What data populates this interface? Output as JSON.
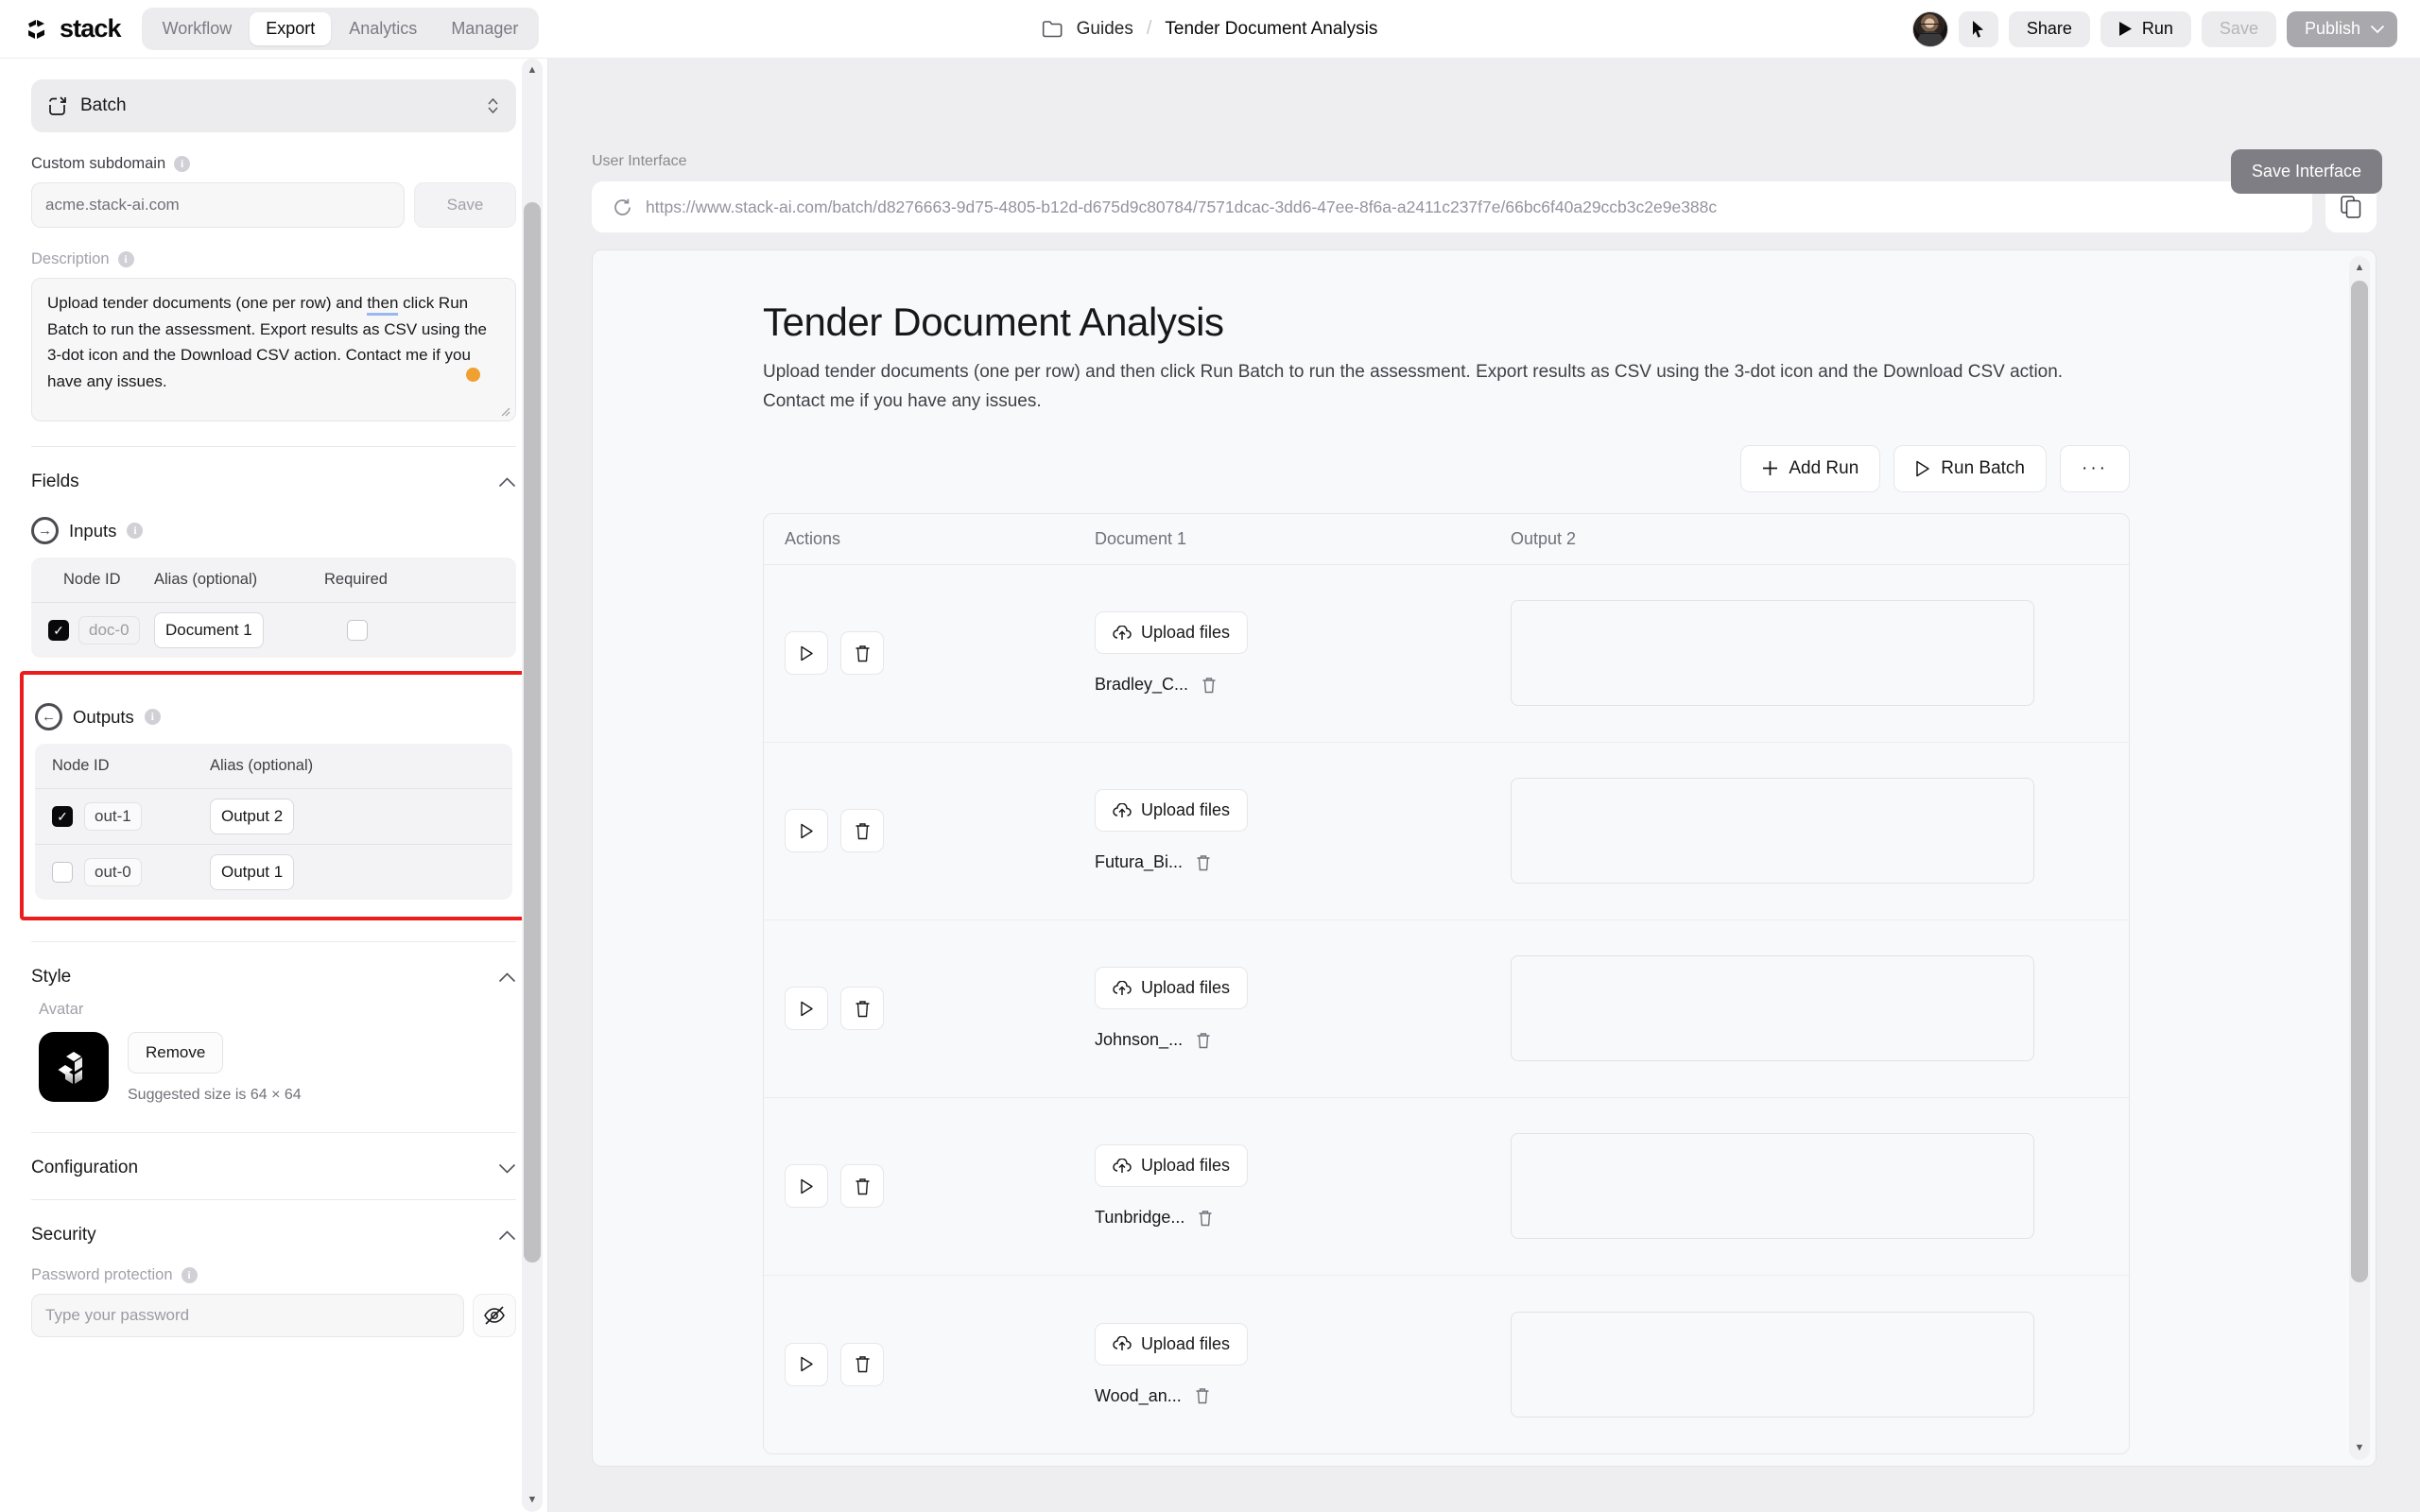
{
  "topbar": {
    "brand_name": "stack",
    "brand_icon": "stack-logo-icon",
    "nav": [
      {
        "label": "Workflow",
        "active": false
      },
      {
        "label": "Export",
        "active": true
      },
      {
        "label": "Analytics",
        "active": false
      },
      {
        "label": "Manager",
        "active": false
      }
    ],
    "breadcrumb": {
      "folder_icon": "folder-icon",
      "parent": "Guides",
      "separator": "/",
      "current": "Tender Document Analysis"
    },
    "avatar_alt": "user-avatar",
    "cursor_icon": "cursor-pointer-icon",
    "share_label": "Share",
    "run_label": "Run",
    "run_icon": "play-icon",
    "save_label": "Save",
    "publish_label": "Publish",
    "publish_chevron": "chevron-down-icon"
  },
  "sidebar": {
    "mode_select": {
      "icon": "batch-icon",
      "value": "Batch",
      "chevron": "chevron-updown-icon"
    },
    "custom_subdomain": {
      "label": "Custom subdomain",
      "info": "info-icon",
      "value": "acme.stack-ai.com",
      "save_label": "Save"
    },
    "description": {
      "label": "Description",
      "info": "info-icon",
      "line1": "Upload tender documents (one per row) and ",
      "line1_spell": "then",
      "line_rest": "click Run Batch to run the assessment. Export results as CSV using the 3-dot icon and the Download CSV action. Contact me if you have any issues."
    },
    "fields": {
      "title": "Fields",
      "chevron": "chevron-up-icon",
      "inputs": {
        "title": "Inputs",
        "icon": "arrow-right-circle-icon",
        "info": "info-icon",
        "columns": [
          "Node ID",
          "Alias (optional)",
          "Required"
        ],
        "rows": [
          {
            "checked": true,
            "node_id": "doc-0",
            "alias": "Document 1",
            "required": false
          }
        ]
      },
      "outputs": {
        "title": "Outputs",
        "icon": "arrow-left-circle-icon",
        "info": "info-icon",
        "columns": [
          "Node ID",
          "Alias (optional)"
        ],
        "rows": [
          {
            "checked": true,
            "node_id": "out-1",
            "alias": "Output 2"
          },
          {
            "checked": false,
            "node_id": "out-0",
            "alias": "Output 1"
          }
        ],
        "highlight_color": "#ec1c1c"
      }
    },
    "style": {
      "title": "Style",
      "chevron": "chevron-up-icon",
      "avatar_label": "Avatar",
      "avatar_icon": "stack-cubes-icon",
      "remove_label": "Remove",
      "hint": "Suggested size is 64 × 64"
    },
    "configuration": {
      "title": "Configuration",
      "chevron": "chevron-down-icon"
    },
    "security": {
      "title": "Security",
      "chevron": "chevron-up-icon",
      "password_label": "Password protection",
      "info": "info-icon",
      "password_placeholder": "Type your password",
      "eye_icon": "eye-off-icon"
    }
  },
  "main": {
    "save_interface_label": "Save Interface",
    "ui_label": "User Interface",
    "refresh_icon": "refresh-icon",
    "url": "https://www.stack-ai.com/batch/d8276663-9d75-4805-b12d-d675d9c80784/7571dcac-3dd6-47ee-8f6a-a2411c237f7e/66bc6f40a29ccb3c2e9e388c",
    "copy_icon": "copy-icon",
    "preview": {
      "title": "Tender Document Analysis",
      "description": "Upload tender documents (one per row) and then click Run Batch to run the assessment. Export results as CSV using the 3-dot icon and the Download CSV action. Contact me if you have any issues.",
      "buttons": {
        "add_run": "Add Run",
        "add_run_icon": "plus-icon",
        "run_batch": "Run Batch",
        "run_batch_icon": "play-outline-icon",
        "more": "···",
        "more_icon": "ellipsis-icon"
      },
      "table": {
        "columns": [
          "Actions",
          "Document 1",
          "Output 2"
        ],
        "upload_label": "Upload files",
        "upload_icon": "cloud-upload-icon",
        "run_icon": "play-outline-icon",
        "delete_icon": "trash-icon",
        "rows": [
          {
            "file": "Bradley_C...",
            "output": ""
          },
          {
            "file": "Futura_Bi...",
            "output": ""
          },
          {
            "file": "Johnson_...",
            "output": ""
          },
          {
            "file": "Tunbridge...",
            "output": ""
          },
          {
            "file": "Wood_an...",
            "output": ""
          }
        ]
      }
    }
  }
}
